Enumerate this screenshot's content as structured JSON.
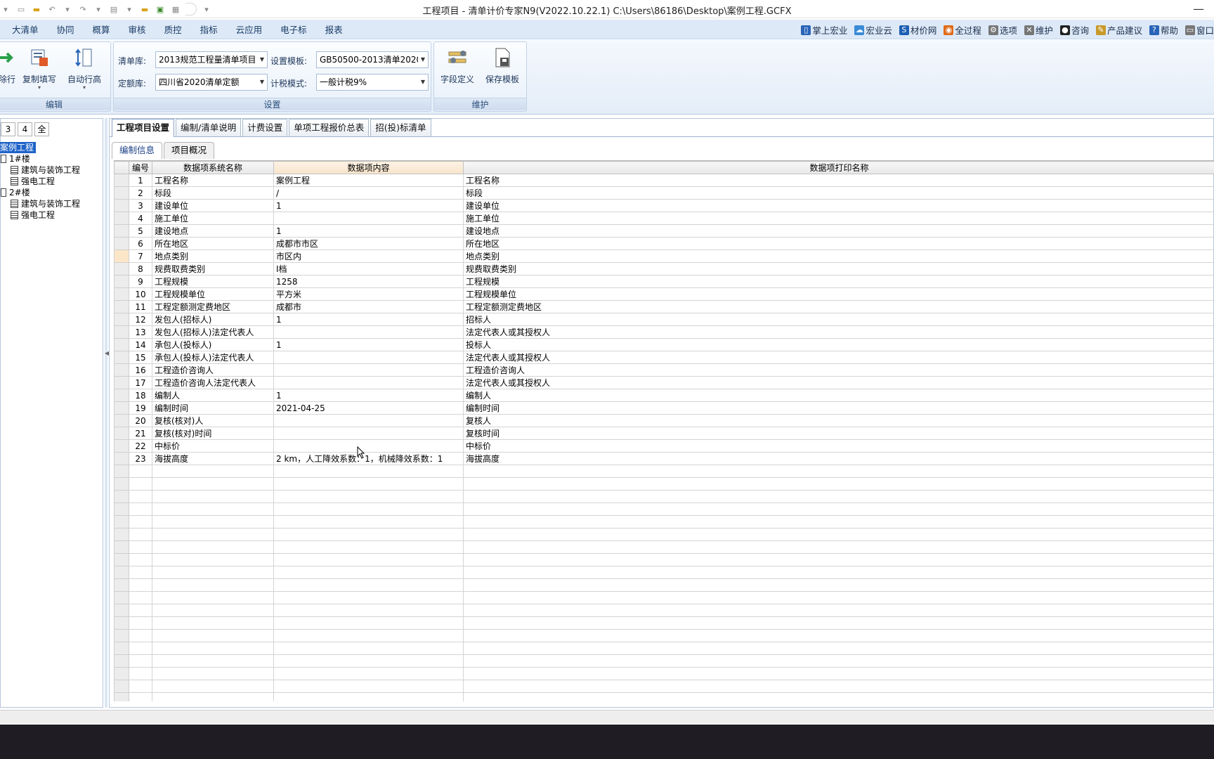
{
  "window": {
    "title": "工程项目 - 清单计价专家N9(V2022.10.22.1) C:\\Users\\86186\\Desktop\\案例工程.GCFX",
    "close_glyph": "—"
  },
  "menu": {
    "items": [
      "大清单",
      "协同",
      "概算",
      "审核",
      "质控",
      "指标",
      "云应用",
      "电子标",
      "报表"
    ],
    "right": [
      {
        "label": "掌上宏业",
        "icon": "phone-icon",
        "color": "#2a64b8"
      },
      {
        "label": "宏业云",
        "icon": "cloud-icon",
        "color": "#3b8bd6"
      },
      {
        "label": "材价网",
        "icon": "s-logo-icon",
        "color": "#1d5fb3"
      },
      {
        "label": "全过程",
        "icon": "process-icon",
        "color": "#e06a1a"
      },
      {
        "label": "选项",
        "icon": "gear-icon",
        "color": "#777777"
      },
      {
        "label": "维护",
        "icon": "tools-icon",
        "color": "#777777"
      },
      {
        "label": "咨询",
        "icon": "qq-icon",
        "color": "#222222"
      },
      {
        "label": "产品建议",
        "icon": "edit-icon",
        "color": "#c89a2a"
      },
      {
        "label": "帮助",
        "icon": "help-icon",
        "color": "#2a64b8"
      },
      {
        "label": "窗口",
        "icon": "window-icon",
        "color": "#777777"
      }
    ]
  },
  "ribbon": {
    "edit_group": {
      "label": "编辑",
      "partial_label": "除行",
      "copy_fill": "复制填写",
      "auto_row_height": "自动行高"
    },
    "settings_group": {
      "label": "设置",
      "list_lib_label": "清单库:",
      "list_lib_value": "2013规范工程量清单项目",
      "quota_lib_label": "定额库:",
      "quota_lib_value": "四川省2020清单定额",
      "template_label": "设置模板:",
      "template_value": "GB50500-2013清单2020版",
      "tax_label": "计税模式:",
      "tax_value": "一般计税9%"
    },
    "maint_group": {
      "label": "维护",
      "field_def": "字段定义",
      "save_template": "保存模板"
    }
  },
  "left_panel": {
    "levels": [
      "3",
      "4",
      "全"
    ],
    "tree": [
      {
        "label": "案例工程",
        "type": "root"
      },
      {
        "label": "1#楼",
        "type": "building"
      },
      {
        "label": "建筑与装饰工程",
        "type": "unit"
      },
      {
        "label": "强电工程",
        "type": "unit"
      },
      {
        "label": "2#楼",
        "type": "building"
      },
      {
        "label": "建筑与装饰工程",
        "type": "unit"
      },
      {
        "label": "强电工程",
        "type": "unit"
      }
    ]
  },
  "tabs": [
    "工程项目设置",
    "编制/清单说明",
    "计费设置",
    "单项工程报价总表",
    "招(投)标清单"
  ],
  "subtabs": [
    "编制信息",
    "项目概况"
  ],
  "grid": {
    "headers": [
      "编号",
      "数据项系统名称",
      "数据项内容",
      "数据项打印名称"
    ],
    "rows": [
      [
        "1",
        "工程名称",
        "案例工程",
        "工程名称"
      ],
      [
        "2",
        "标段",
        "/",
        "标段"
      ],
      [
        "3",
        "建设单位",
        "1",
        "建设单位"
      ],
      [
        "4",
        "施工单位",
        "",
        "施工单位"
      ],
      [
        "5",
        "建设地点",
        "1",
        "建设地点"
      ],
      [
        "6",
        "所在地区",
        "成都市市区",
        "所在地区"
      ],
      [
        "7",
        "地点类别",
        "市区内",
        "地点类别"
      ],
      [
        "8",
        "规费取费类别",
        "Ⅰ档",
        "规费取费类别"
      ],
      [
        "9",
        "工程规模",
        "1258",
        "工程规模"
      ],
      [
        "10",
        "工程规模单位",
        "平方米",
        "工程规模单位"
      ],
      [
        "11",
        "工程定额测定费地区",
        "成都市",
        "工程定额测定费地区"
      ],
      [
        "12",
        "发包人(招标人)",
        "1",
        "招标人"
      ],
      [
        "13",
        "发包人(招标人)法定代表人",
        "",
        "法定代表人或其授权人"
      ],
      [
        "14",
        "承包人(投标人)",
        "1",
        "投标人"
      ],
      [
        "15",
        "承包人(投标人)法定代表人",
        "",
        "法定代表人或其授权人"
      ],
      [
        "16",
        "工程造价咨询人",
        "",
        "工程造价咨询人"
      ],
      [
        "17",
        "工程造价咨询人法定代表人",
        "",
        "法定代表人或其授权人"
      ],
      [
        "18",
        "编制人",
        "1",
        "编制人"
      ],
      [
        "19",
        "编制时间",
        "2021-04-25",
        "编制时间"
      ],
      [
        "20",
        "复核(核对)人",
        "",
        "复核人"
      ],
      [
        "21",
        "复核(核对)时间",
        "",
        "复核时间"
      ],
      [
        "22",
        "中标价",
        "",
        "中标价"
      ],
      [
        "23",
        "海拔高度",
        "2 km，人工降效系数：1，机械降效系数：1",
        "海拔高度"
      ]
    ]
  }
}
